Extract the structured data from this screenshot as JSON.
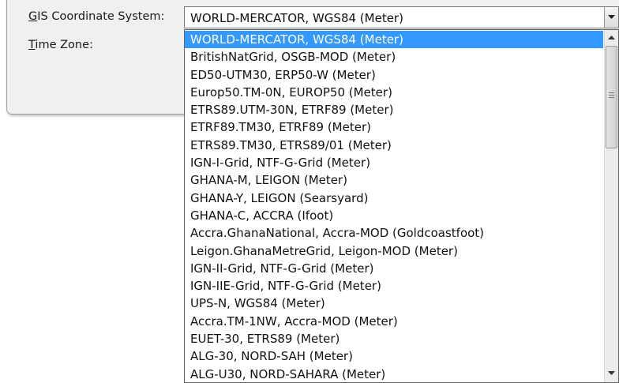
{
  "form": {
    "gis_label_accel": "G",
    "gis_label_rest": "IS Coordinate System:",
    "tz_label_accel": "T",
    "tz_label_rest": "ime Zone:"
  },
  "combo": {
    "selected_value": "WORLD-MERCATOR, WGS84 (Meter)",
    "button_icon": "chevron-down-icon"
  },
  "dropdown": {
    "selected_index": 0,
    "options": [
      "WORLD-MERCATOR, WGS84 (Meter)",
      "BritishNatGrid, OSGB-MOD (Meter)",
      "ED50-UTM30, ERP50-W (Meter)",
      "Europ50.TM-0N, EUROP50 (Meter)",
      "ETRS89.UTM-30N, ETRF89 (Meter)",
      "ETRF89.TM30, ETRF89 (Meter)",
      "ETRS89.TM30, ETRS89/01 (Meter)",
      "IGN-I-Grid, NTF-G-Grid (Meter)",
      "GHANA-M, LEIGON (Meter)",
      "GHANA-Y, LEIGON (Searsyard)",
      "GHANA-C, ACCRA (Ifoot)",
      "Accra.GhanaNational, Accra-MOD (Goldcoastfoot)",
      "Leigon.GhanaMetreGrid, Leigon-MOD (Meter)",
      "IGN-II-Grid, NTF-G-Grid (Meter)",
      "IGN-IIE-Grid, NTF-G-Grid (Meter)",
      "UPS-N, WGS84 (Meter)",
      "Accra.TM-1NW, Accra-MOD (Meter)",
      "EUET-30, ETRS89 (Meter)",
      "ALG-30, NORD-SAH (Meter)",
      "ALG-U30, NORD-SAHARA (Meter)"
    ]
  },
  "colors": {
    "selection": "#3399ff",
    "selection_text": "#ffffff"
  }
}
